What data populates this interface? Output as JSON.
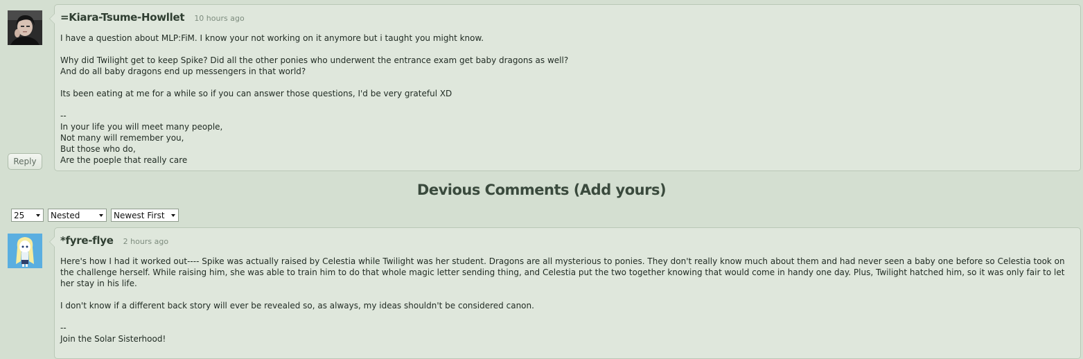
{
  "comments": [
    {
      "author": "=Kiara-Tsume-Howllet",
      "time": "10 hours ago",
      "avatar_icon": "user-photo-avatar-icon",
      "paragraphs": [
        [
          "I have a question about MLP:FiM. I know your not working on it anymore but i taught you might know."
        ],
        [
          "Why did Twilight get to keep Spike? Did all the other ponies who underwent the entrance exam get baby dragons as well?",
          "And do all baby dragons end up messengers in that world?"
        ],
        [
          "Its been eating at me for a while so if you can answer those questions, I'd be very grateful XD"
        ],
        [
          "--",
          "In your life you will meet many people,",
          "Not many will remember you,",
          "But those who do,",
          "Are the poeple that really care"
        ]
      ]
    },
    {
      "author": "*fyre-flye",
      "time": "2 hours ago",
      "avatar_icon": "cartoon-pony-avatar-icon",
      "paragraphs": [
        [
          "Here's how I had it worked out---- Spike was actually raised by Celestia while Twilight was her student. Dragons are all mysterious to ponies. They don't really know much about them and had never seen a baby one before so Celestia took on the challenge herself. While raising him, she was able to train him to do that whole magic letter sending thing, and Celestia put the two together knowing that would come in handy one day. Plus, Twilight hatched him, so it was only fair to let her stay in his life."
        ],
        [
          "I don't know if a different back story will ever be revealed so, as always, my ideas shouldn't be considered canon."
        ],
        [
          "--",
          "Join the Solar Sisterhood!"
        ]
      ]
    }
  ],
  "reply_label": "Reply",
  "section": {
    "title_prefix": "Devious Comments (",
    "add_link": "Add yours",
    "title_suffix": ")"
  },
  "controls": {
    "per_page": "25",
    "view_mode": "Nested",
    "sort_order": "Newest First"
  }
}
